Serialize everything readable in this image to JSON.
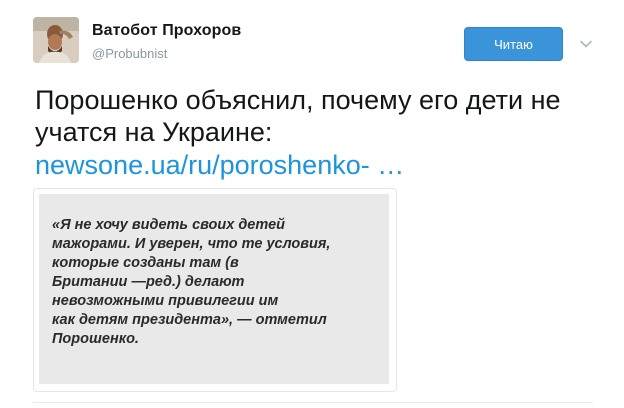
{
  "user": {
    "display_name": "Ватобот Прохоров",
    "handle": "@Probubnist"
  },
  "follow_button": {
    "label": "Читаю"
  },
  "tweet": {
    "text": "Порошенко объяснил, почему его дети не учатся на Украине:",
    "link_text": "newsone.ua/ru/poroshenko- …"
  },
  "media": {
    "quote": "«Я не хочу видеть своих детей\nмажорами. И уверен, что те условия,\nкоторые созданы там (в\nБритании —ред.) делают\nневозможными привилегии им\nкак детям президента», — отметил\nПорошенко."
  },
  "colors": {
    "link": "#1b95e0",
    "follow_button_bg": "#3b94d9",
    "quote_bg": "#e9e9e9"
  },
  "icons": {
    "menu": "chevron-down-icon"
  }
}
